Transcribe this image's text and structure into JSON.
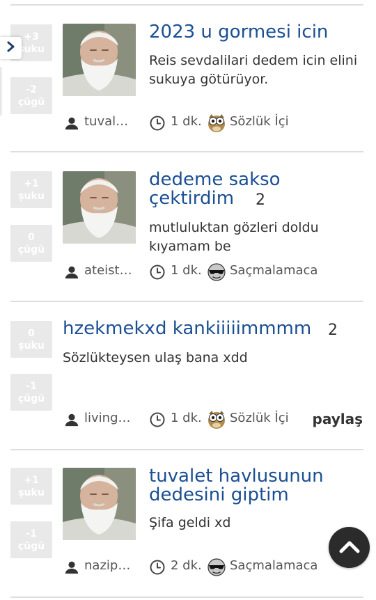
{
  "posts": [
    {
      "up": "+3",
      "up_label": "şuku",
      "down": "-2",
      "down_label": "çügü",
      "title": "2023 u gormesi icin",
      "title_count": "",
      "content": "Reis sevdalilari dedem icin elini sukuya götürüyor.",
      "user": "tuvaletkağıdı",
      "time": "1 dk.",
      "category": "Sözlük İçi",
      "category_icon": "owl-icon",
      "share": ""
    },
    {
      "up": "+1",
      "up_label": "şuku",
      "down": "0",
      "down_label": "çügü",
      "title": "dedeme sakso çektirdim",
      "title_count": "2",
      "content": "mutluluktan gözleri doldu kıyamam be",
      "user": "ateist dede",
      "time": "1 dk.",
      "category": "Saçmalamaca",
      "category_icon": "sunglasses-face-icon",
      "share": ""
    },
    {
      "up": "0",
      "up_label": "şuku",
      "down": "-1",
      "down_label": "çügü",
      "title": "hzekmekxd kankiiiiimmmm",
      "title_count": "2",
      "content": "Sözlükteysen ulaş bana xdd",
      "user": "living dead",
      "time": "1 dk.",
      "category": "Sözlük İçi",
      "category_icon": "owl-icon",
      "share": "paylaş"
    },
    {
      "up": "+1",
      "up_label": "şuku",
      "down": "-1",
      "down_label": "çügü",
      "title": "tuvalet havlusunun dedesini giptim",
      "title_count": "",
      "content": "Şifa geldi xd",
      "user": "nazipasa",
      "time": "2 dk.",
      "category": "Saçmalamaca",
      "category_icon": "sunglasses-face-icon",
      "share": ""
    }
  ],
  "colors": {
    "title": "#1b4f93",
    "vote_box": "#e9e9e9",
    "scroll_button": "#2b2b2b"
  },
  "icons": {
    "side_toggle": "chevron-right-icon",
    "user": "user-icon",
    "time": "clock-icon",
    "scroll_top": "chevron-up-icon"
  }
}
